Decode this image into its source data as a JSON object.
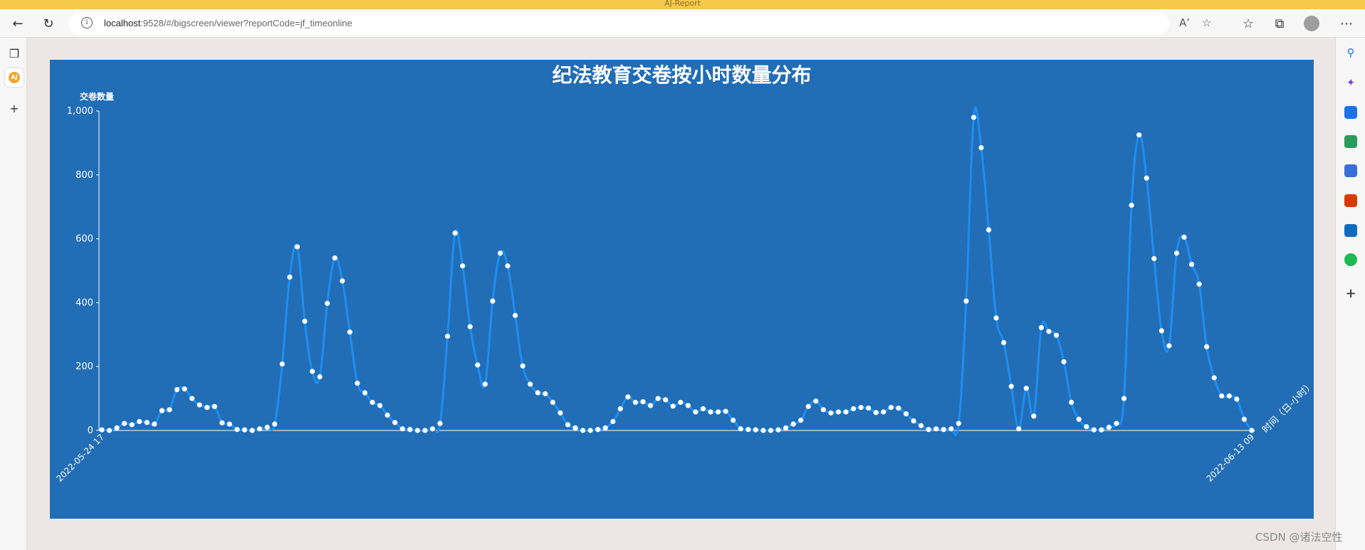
{
  "browser": {
    "window_title": "AJ-Report",
    "url_host": "localhost",
    "url_rest": ":9528/#/bigscreen/viewer?reportCode=jf_timeonline",
    "info_icon": "i"
  },
  "watermark": "CSDN @诸法空性",
  "colors": {
    "report_background": "#216db6",
    "line": "#1f8ef0",
    "marker": "#ffffff",
    "axis_text": "#ffffff"
  },
  "chart_data": {
    "type": "line",
    "title": "纪法教育交卷按小时数量分布",
    "ylabel": "交卷数量",
    "xlabel": "时间（日-小时）",
    "ylim": [
      0,
      1000
    ],
    "yticks": [
      "0",
      "200",
      "400",
      "600",
      "800",
      "1,000"
    ],
    "smooth": true,
    "grid": false,
    "x_tick_labels_visible": [
      "2022-05-24 17",
      "2022-06-13 09"
    ],
    "values": [
      2,
      0,
      8,
      22,
      18,
      28,
      25,
      20,
      62,
      65,
      128,
      130,
      100,
      80,
      72,
      75,
      24,
      20,
      3,
      2,
      0,
      5,
      10,
      20,
      208,
      480,
      575,
      342,
      185,
      168,
      398,
      540,
      468,
      308,
      148,
      118,
      88,
      78,
      48,
      25,
      5,
      3,
      0,
      0,
      5,
      22,
      295,
      618,
      515,
      325,
      205,
      145,
      405,
      555,
      515,
      360,
      202,
      145,
      118,
      115,
      88,
      55,
      18,
      8,
      0,
      0,
      3,
      8,
      28,
      68,
      105,
      88,
      90,
      78,
      100,
      96,
      76,
      88,
      78,
      58,
      68,
      58,
      58,
      60,
      32,
      5,
      3,
      2,
      0,
      0,
      2,
      8,
      20,
      32,
      75,
      92,
      65,
      55,
      58,
      58,
      68,
      72,
      70,
      56,
      58,
      72,
      70,
      52,
      30,
      15,
      3,
      5,
      3,
      5,
      22,
      405,
      980,
      885,
      628,
      352,
      275,
      138,
      5,
      132,
      45,
      322,
      310,
      298,
      215,
      88,
      35,
      12,
      2,
      2,
      10,
      22,
      100,
      705,
      925,
      790,
      538,
      312,
      265,
      555,
      605,
      520,
      458,
      262,
      165,
      108,
      108,
      98,
      35,
      0
    ]
  }
}
